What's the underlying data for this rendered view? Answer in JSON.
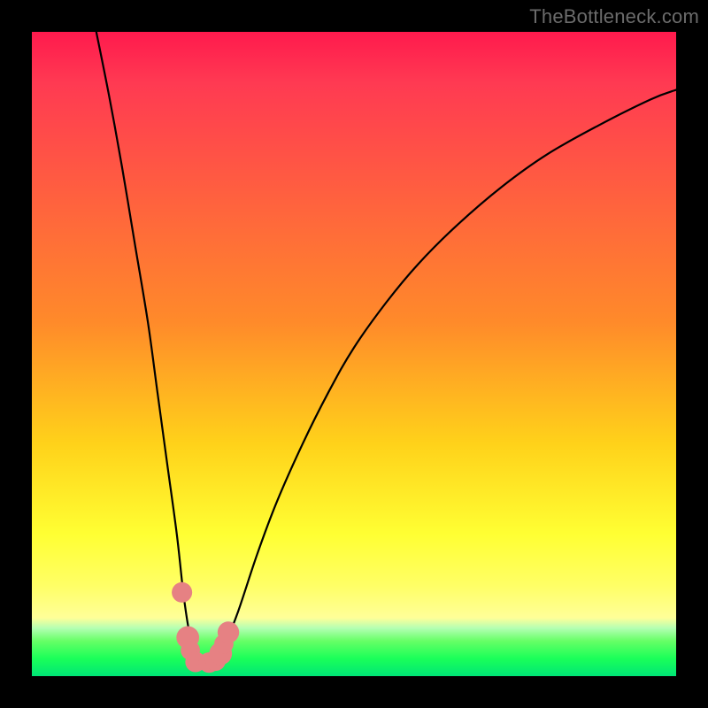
{
  "watermark": "TheBottleneck.com",
  "colors": {
    "bg_black": "#000000",
    "grad_top": "#ff1a4d",
    "grad_mid1": "#ff8a2a",
    "grad_mid2": "#ffd21a",
    "grad_yellow": "#ffff33",
    "grad_paleyellow": "#ffff99",
    "green_pale": "#b3ffb3",
    "green_light": "#66ff66",
    "green_mid": "#1aff59",
    "green_deep": "#00e676",
    "curve": "#000000",
    "marker": "#e68183"
  },
  "chart_data": {
    "type": "line",
    "title": "",
    "xlabel": "",
    "ylabel": "",
    "xlim": [
      0,
      100
    ],
    "ylim": [
      0,
      100
    ],
    "x": [
      10,
      12,
      14,
      16,
      18,
      19.5,
      21,
      22.5,
      23.5,
      24.3,
      25,
      26,
      27,
      28,
      29,
      30,
      32,
      35,
      38,
      42,
      46,
      50,
      55,
      60,
      66,
      73,
      80,
      88,
      96,
      100
    ],
    "values": [
      100,
      90,
      79,
      67,
      55,
      44,
      33,
      22,
      13,
      7.5,
      4.3,
      2.4,
      2.0,
      2.2,
      3.0,
      5.0,
      10,
      19,
      27,
      36,
      44,
      51,
      58,
      64,
      70,
      76,
      81,
      85.5,
      89.5,
      91
    ],
    "markers": [
      {
        "x": 23.3,
        "y": 13.0,
        "r": 1.0
      },
      {
        "x": 24.2,
        "y": 6.0,
        "r": 1.2
      },
      {
        "x": 24.6,
        "y": 4.0,
        "r": 0.9
      },
      {
        "x": 25.4,
        "y": 2.2,
        "r": 1.0
      },
      {
        "x": 27.5,
        "y": 2.1,
        "r": 1.0
      },
      {
        "x": 28.5,
        "y": 2.4,
        "r": 1.0
      },
      {
        "x": 29.3,
        "y": 3.5,
        "r": 1.2
      },
      {
        "x": 29.8,
        "y": 5.0,
        "r": 0.9
      },
      {
        "x": 30.5,
        "y": 6.8,
        "r": 1.1
      }
    ],
    "green_band": {
      "top_pct": 91,
      "bottom_pct": 100
    }
  }
}
